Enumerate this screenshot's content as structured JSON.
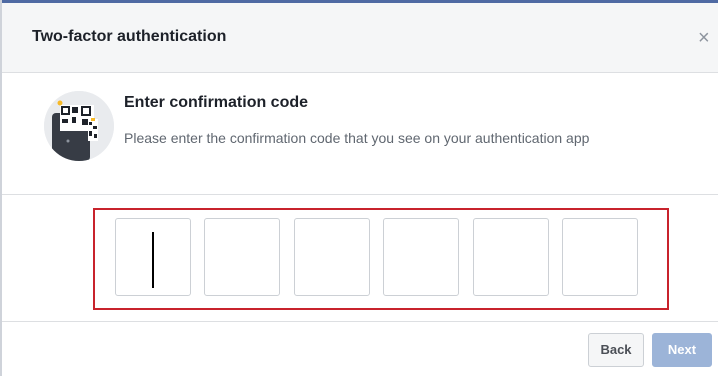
{
  "dialog": {
    "title": "Two-factor authentication",
    "close_icon": "×"
  },
  "step": {
    "icon": "qr-code-phone-icon",
    "title": "Enter confirmation code",
    "description": "Please enter the confirmation code that you see on your authentication app"
  },
  "code_inputs": [
    "",
    "",
    "",
    "",
    "",
    ""
  ],
  "buttons": {
    "back": "Back",
    "next": "Next"
  },
  "colors": {
    "highlight": "#c8232c",
    "next_disabled": "#9cb4d8",
    "header_bg": "#f5f6f7"
  }
}
